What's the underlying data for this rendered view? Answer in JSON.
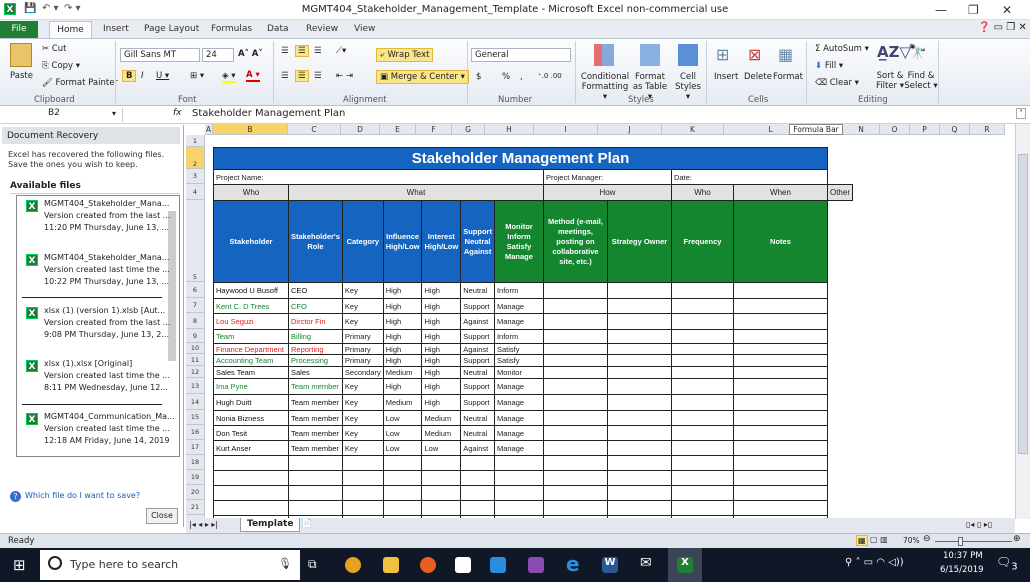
{
  "window": {
    "title": "MGMT404_Stakeholder_Management_Template  -  Microsoft Excel non-commercial use"
  },
  "ribbon_tabs": [
    "File",
    "Home",
    "Insert",
    "Page Layout",
    "Formulas",
    "Data",
    "Review",
    "View"
  ],
  "ribbon": {
    "paste": "Paste",
    "cut": "Cut",
    "copy": "Copy ▾",
    "format_painter": "Format Painter",
    "clipboard": "Clipboard",
    "font_name": "Gill Sans MT",
    "font_size": "24",
    "font": "Font",
    "wrap_text": "Wrap Text",
    "merge_center": "Merge & Center",
    "alignment": "Alignment",
    "number_format": "General",
    "number": "Number",
    "currency": "$",
    "percent": "%",
    "comma": ",",
    "conditional_formatting": "Conditional Formatting ▾",
    "format_as_table": "Format as Table ▾",
    "cell_styles": "Cell Styles ▾",
    "styles": "Styles",
    "insert": "Insert",
    "delete": "Delete",
    "format": "Format",
    "cells": "Cells",
    "autosum": "Σ AutoSum ▾",
    "fill": "Fill ▾",
    "clear": "Clear ▾",
    "sort_filter": "Sort & Filter ▾",
    "find_select": "Find & Select ▾",
    "editing": "Editing"
  },
  "formula_bar": {
    "name_box": "B2",
    "fx": "fx",
    "content": "Stakeholder Management Plan",
    "tooltip": "Formula Bar"
  },
  "recovery": {
    "title": "Document Recovery",
    "message": "Excel has recovered the following files.  Save the ones you wish to keep.",
    "available": "Available files",
    "files": [
      {
        "name": "MGMT404_Stakeholder_Mana...",
        "desc": "Version created from the last ...",
        "time": "11:20 PM Thursday, June 13, ..."
      },
      {
        "name": "MGMT404_Stakeholder_Mana...",
        "desc": "Version created last time the ...",
        "time": "10:22 PM Thursday, June 13, ..."
      },
      {
        "name": "xlsx (1) (version 1).xlsb  [Aut...",
        "desc": "Version created from the last ...",
        "time": "9:08 PM Thursday, June 13, 2..."
      },
      {
        "name": "xlsx (1).xlsx  [Original]",
        "desc": "Version created last time the ...",
        "time": "8:11 PM Wednesday, June 12..."
      },
      {
        "name": "MGMT404_Communication_Ma...",
        "desc": "Version created last time the ...",
        "time": "12:18 AM Friday, June 14, 2019"
      }
    ],
    "help": "Which file do I want to save?",
    "close": "Close"
  },
  "columns": [
    "A",
    "B",
    "C",
    "D",
    "E",
    "F",
    "G",
    "H",
    "I",
    "J",
    "K",
    "L",
    "M",
    "N",
    "O",
    "P",
    "Q",
    "R"
  ],
  "sheet": {
    "title": "Stakeholder Management Plan",
    "project_name": "Project Name:",
    "project_manager": "Project Manager:",
    "date": "Date:",
    "groups": [
      "Who",
      "What",
      "How",
      "Who",
      "When",
      "Other"
    ],
    "headers": [
      "Stakeholder",
      "Stakeholder's Role",
      "Category",
      "Influence High/Low",
      "Interest High/Low",
      "Support Neutral Against",
      "Monitor Inform Satisfy Manage",
      "Method (e-mail, meetings, posting on collaborative site, etc.)",
      "Strategy Owner",
      "Frequency",
      "Notes"
    ],
    "rows": [
      {
        "cells": [
          "Haywood U Busoff",
          "CEO",
          "Key",
          "High",
          "High",
          "Neutral",
          "Inform"
        ],
        "color": "black"
      },
      {
        "cells": [
          "Kent C. D Trees",
          "CFO",
          "Key",
          "High",
          "High",
          "Support",
          "Manage"
        ],
        "color": "green"
      },
      {
        "cells": [
          "Lou Seguzi",
          "Dirctor Fin",
          "Key",
          "High",
          "High",
          "Against",
          "Manage"
        ],
        "color": "red"
      },
      {
        "cells": [
          "Team",
          "Billing",
          "Primary",
          "High",
          "High",
          "Support",
          "Inform"
        ],
        "color": "green"
      },
      {
        "cells": [
          "Finance Department",
          "Reporting",
          "Primary",
          "High",
          "High",
          "Against",
          "Satisfy"
        ],
        "color": "red"
      },
      {
        "cells": [
          "Accounting Team",
          "Processing",
          "Primary",
          "High",
          "High",
          "Support",
          "Satisfy"
        ],
        "color": "green"
      },
      {
        "cells": [
          "Sales Team",
          "Sales",
          "Secondary",
          "Medium",
          "High",
          "Neutral",
          "Monitor"
        ],
        "color": "black"
      },
      {
        "cells": [
          "Ima Pyne",
          "Team member",
          "Key",
          "High",
          "High",
          "Support",
          "Manage"
        ],
        "color": "green"
      },
      {
        "cells": [
          "Hugh Duitt",
          "Team member",
          "Key",
          "Medium",
          "High",
          "Support",
          "Manage"
        ],
        "color": "black"
      },
      {
        "cells": [
          "Nonia Bizness",
          "Team member",
          "Key",
          "Low",
          "Medium",
          "Neutral",
          "Manage"
        ],
        "color": "black"
      },
      {
        "cells": [
          "Don Tesit",
          "Team member",
          "Key",
          "Low",
          "Medium",
          "Neutral",
          "Manage"
        ],
        "color": "black"
      },
      {
        "cells": [
          "Kurt Anser",
          "Team member",
          "Key",
          "Low",
          "Low",
          "Against",
          "Manage"
        ],
        "color": "black"
      }
    ]
  },
  "sheet_tabs": [
    "Template"
  ],
  "status": {
    "text": "Ready",
    "zoom": "70%"
  },
  "taskbar": {
    "search_placeholder": "Type here to search",
    "time": "10:37 PM",
    "date": "6/15/2019",
    "notifications": "3"
  },
  "colors": {
    "blue_header": "#1565c0",
    "green_header": "#14862f",
    "excel_green": "#1e7f35"
  }
}
